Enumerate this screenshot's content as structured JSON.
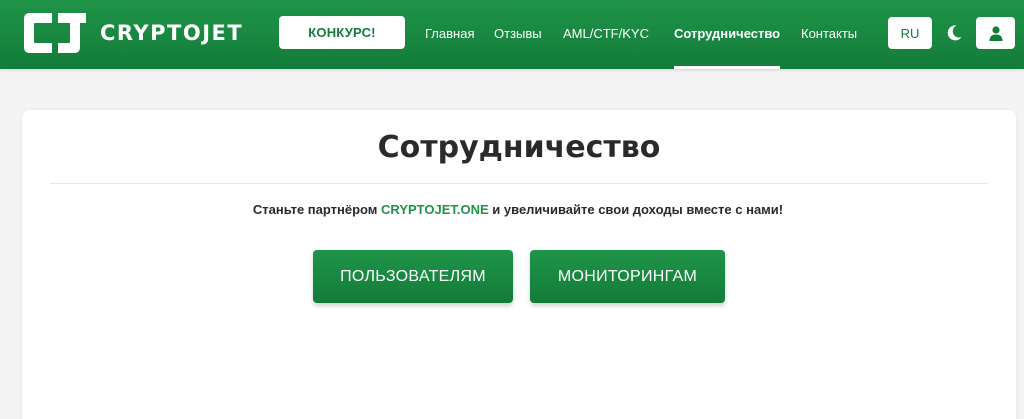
{
  "header": {
    "logo_text": "CRYPTOJET",
    "contest_label": "КОНКУРС!",
    "nav": [
      {
        "label": "Главная",
        "active": false
      },
      {
        "label": "Отзывы",
        "active": false
      },
      {
        "label": "AML/CTF/KYC",
        "active": false
      },
      {
        "label": "Сотрудничество",
        "active": true
      },
      {
        "label": "Контакты",
        "active": false
      }
    ],
    "lang": "RU",
    "theme_icon": "moon-icon",
    "user_icon": "user-icon"
  },
  "main": {
    "title": "Сотрудничество",
    "tagline_before": "Станьте партнёром ",
    "tagline_brand": "CRYPTOJET.ONE",
    "tagline_after": " и увеличивайте свои доходы вместе с нами!",
    "buttons": [
      {
        "label": "ПОЛЬЗОВАТЕЛЯМ"
      },
      {
        "label": "МОНИТОРИНГАМ"
      }
    ]
  },
  "colors": {
    "brand_green": "#1f9448",
    "brand_green_dark": "#137c3a",
    "page_bg": "#f4f4f4",
    "card_bg": "#ffffff",
    "text_dark": "#2a2a2a"
  }
}
